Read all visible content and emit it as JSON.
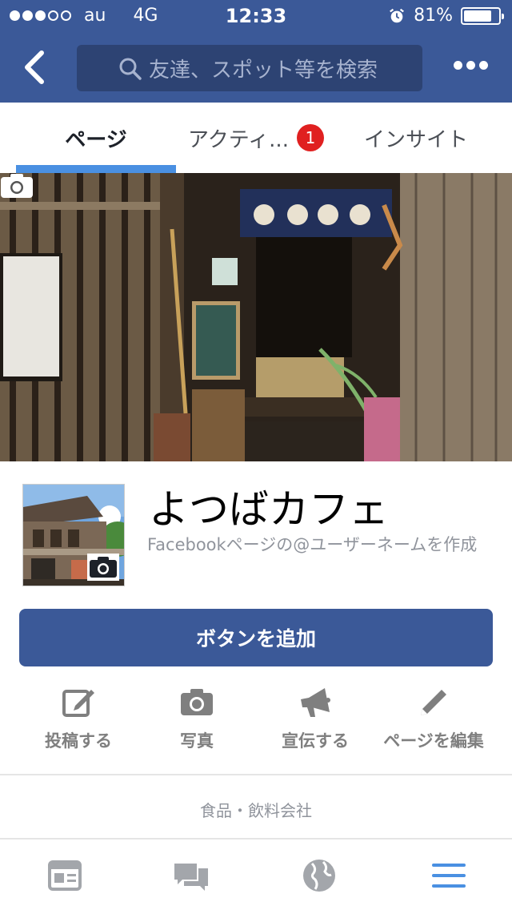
{
  "status_bar": {
    "carrier": "au",
    "network": "4G",
    "time": "12:33",
    "battery_text": "81%",
    "battery_level": 0.81,
    "signal_bars_filled": 3,
    "signal_bars_total": 5
  },
  "nav": {
    "search_placeholder": "友達、スポット等を検索"
  },
  "tabs": [
    {
      "label": "ページ",
      "active": true
    },
    {
      "label": "アクティ...",
      "badge": "1"
    },
    {
      "label": "インサイト"
    }
  ],
  "page": {
    "name": "よつばカフェ",
    "username_hint": "Facebookページの@ユーザーネームを作成",
    "add_button": "ボタンを追加",
    "category": "食品・飲料会社"
  },
  "actions": [
    {
      "icon": "compose-icon",
      "label": "投稿する"
    },
    {
      "icon": "camera-icon",
      "label": "写真"
    },
    {
      "icon": "megaphone-icon",
      "label": "宣伝する"
    },
    {
      "icon": "pencil-icon",
      "label": "ページを編集"
    }
  ],
  "bottom_nav": [
    "news-feed-icon",
    "messages-icon",
    "globe-icon",
    "menu-icon"
  ],
  "colors": {
    "brand": "#3b5998",
    "tab_active": "#4a90e2",
    "badge": "#e02020",
    "icon_gray": "#90949c"
  }
}
